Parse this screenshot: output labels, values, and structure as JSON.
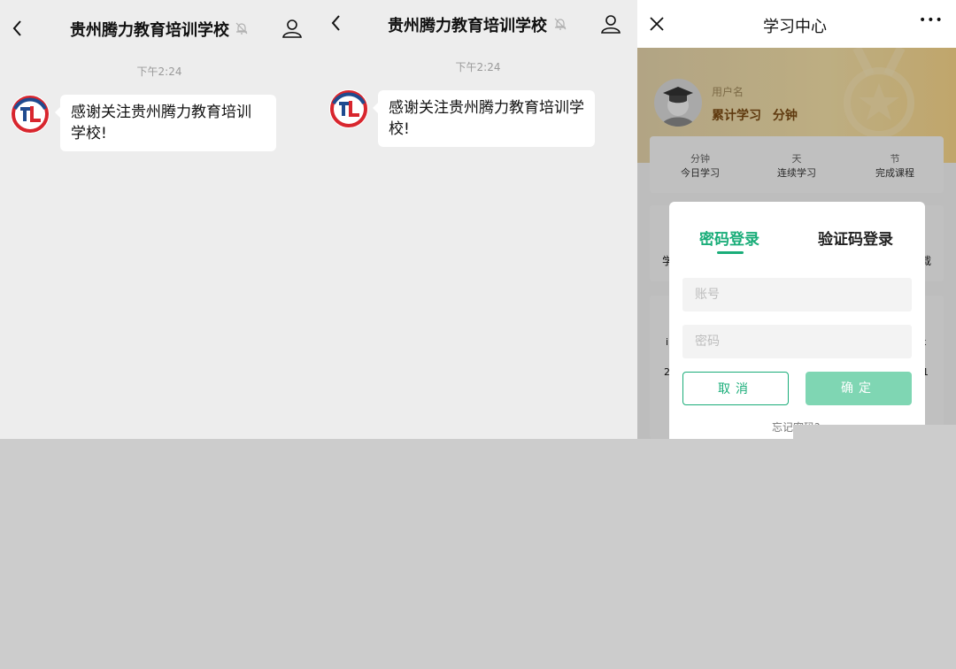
{
  "panel1": {
    "title": "贵州腾力教育培训学校",
    "time": "下午2:24",
    "message": "感谢关注贵州腾力教育培训学校!"
  },
  "panel2": {
    "title": "贵州腾力教育培训学校",
    "time": "下午2:24",
    "message": "感谢关注贵州腾力教育培训学校!"
  },
  "panel3": {
    "title": "学习中心",
    "more": "•••",
    "username": "用户名",
    "cumulative_prefix": "累计学习",
    "cumulative_unit": "分钟",
    "stats": [
      {
        "unit": "分钟",
        "label": "今日学习"
      },
      {
        "unit": "天",
        "label": "连续学习"
      },
      {
        "unit": "节",
        "label": "完成课程"
      }
    ],
    "bg_left_char": "学",
    "bg_right_char": "载",
    "bg_row2_left": "i",
    "bg_row2_right": "k",
    "bg_row3_left": "2",
    "bg_row3_right": "1"
  },
  "login": {
    "tab_password": "密码登录",
    "tab_code": "验证码登录",
    "account_placeholder": "账号",
    "password_placeholder": "密码",
    "cancel": "取消",
    "confirm": "确定",
    "forgot": "忘记密码?"
  },
  "colors": {
    "accent": "#1aad79",
    "confirm_bg": "#7fd6b3",
    "chat_bg": "#ededed",
    "logo_red": "#d8262e",
    "logo_blue": "#1f4b8f"
  }
}
